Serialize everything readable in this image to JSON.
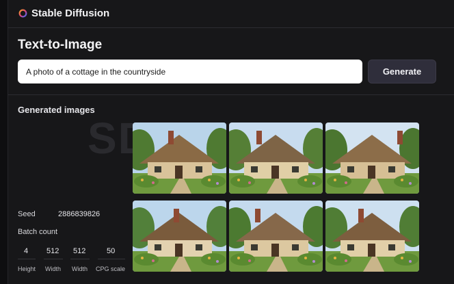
{
  "app": {
    "title": "Stable Diffusion"
  },
  "page": {
    "title": "Text-to-Image"
  },
  "prompt": {
    "value": "A photo of a cottage in the countryside"
  },
  "generate_button": {
    "label": "Generate"
  },
  "results": {
    "title": "Generated images",
    "watermark": "SD",
    "images": [
      {
        "alt": "cottage-1"
      },
      {
        "alt": "cottage-2"
      },
      {
        "alt": "cottage-3"
      },
      {
        "alt": "cottage-4"
      },
      {
        "alt": "cottage-5"
      },
      {
        "alt": "cottage-6"
      }
    ]
  },
  "params": {
    "seed_label": "Seed",
    "seed_value": "2886839826",
    "batch_label": "Batch count",
    "height_value": "4",
    "height_label": "Height",
    "width1_value": "512",
    "width1_label": "Width",
    "width2_value": "512",
    "width2_label": "Width",
    "cfg_value": "50",
    "cfg_label": "CPG scale"
  },
  "colors": {
    "background": "#171719",
    "button": "#2f2e3b",
    "input": "#ffffff",
    "logo_ring": "#7b5cff"
  }
}
